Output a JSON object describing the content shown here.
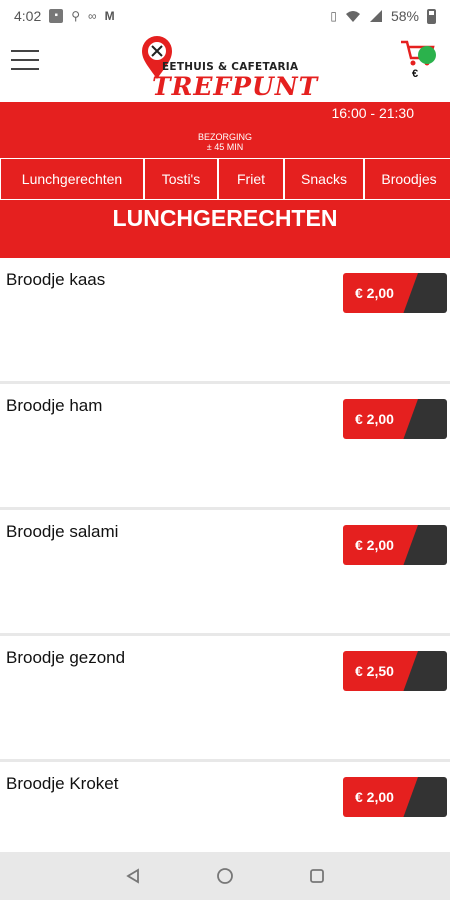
{
  "status_bar": {
    "time": "4:02",
    "battery": "58%"
  },
  "header": {
    "logo_sub": "EETHUIS & CAFETARIA",
    "logo_main": "TREFPUNT",
    "cart_euro": "€"
  },
  "info": {
    "hours": "16:00 - 21:30",
    "delivery_line1": "BEZORGING",
    "delivery_line2": "± 45 MIN"
  },
  "tabs": [
    "Lunchgerechten",
    "Tosti's",
    "Friet",
    "Snacks",
    "Broodjes"
  ],
  "section_title": "LUNCHGERECHTEN",
  "items": [
    {
      "name": "Broodje kaas",
      "price": "€ 2,00"
    },
    {
      "name": "Broodje ham",
      "price": "€ 2,00"
    },
    {
      "name": "Broodje salami",
      "price": "€ 2,00"
    },
    {
      "name": "Broodje gezond",
      "price": "€ 2,50"
    },
    {
      "name": "Broodje Kroket",
      "price": "€ 2,00"
    }
  ],
  "colors": {
    "brand_red": "#e5201f",
    "dark": "#333333",
    "cart_dot": "#2bb24c"
  },
  "icons": [
    "menu-icon",
    "location-pin-icon",
    "cart-icon",
    "back-icon",
    "home-icon",
    "recents-icon"
  ]
}
